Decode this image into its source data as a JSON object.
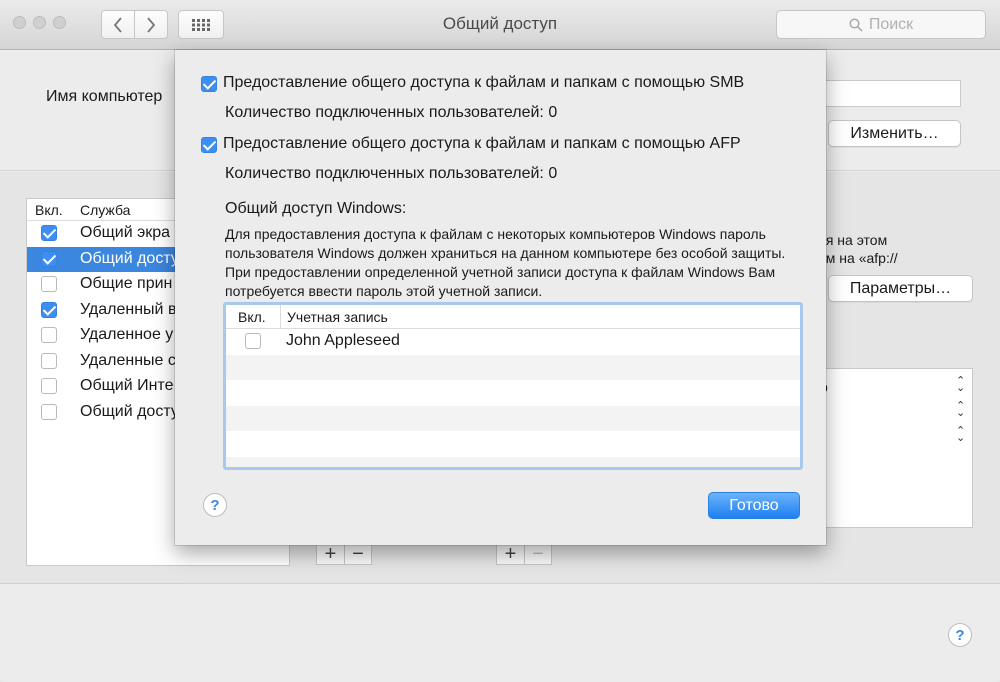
{
  "window": {
    "title": "Общий доступ",
    "search_placeholder": "Поиск"
  },
  "computer_name": {
    "label": "Имя компьютер",
    "change_button": "Изменить…"
  },
  "services": {
    "header_on": "Вкл.",
    "header_service": "Служба",
    "items": [
      {
        "label": "Общий экра",
        "checked": true
      },
      {
        "label": "Общий досту",
        "checked": true,
        "selected": true
      },
      {
        "label": "Общие прин",
        "checked": false
      },
      {
        "label": "Удаленный в",
        "checked": true
      },
      {
        "label": "Удаленное у",
        "checked": false
      },
      {
        "label": "Удаленные с",
        "checked": false
      },
      {
        "label": "Общий Инте",
        "checked": false
      },
      {
        "label": "Общий досту",
        "checked": false
      }
    ]
  },
  "background_right": {
    "text_line1": "ия на этом",
    "text_line2": "ам на «afp://",
    "options_button": "Параметры…",
    "list_fragment": "р"
  },
  "sheet": {
    "smb": {
      "label": "Предоставление общего доступа к файлам и папкам с помощью SMB",
      "checked": true,
      "count": "Количество подключенных пользователей: 0"
    },
    "afp": {
      "label": "Предоставление общего доступа к файлам и папкам с помощью AFP",
      "checked": true,
      "count": "Количество подключенных пользователей: 0"
    },
    "windows_title": "Общий доступ Windows:",
    "windows_description": "Для предоставления доступа к файлам с некоторых компьютеров Windows пароль пользователя Windows должен храниться на данном компьютере без особой защиты. При предоставлении определенной учетной записи доступа к файлам Windows Вам потребуется ввести пароль этой учетной записи.",
    "accounts": {
      "header_on": "Вкл.",
      "header_account": "Учетная запись",
      "rows": [
        {
          "name": "John Appleseed",
          "checked": false
        }
      ]
    },
    "done_button": "Готово"
  },
  "colors": {
    "accent": "#3d8ef0",
    "selection": "#3b86df"
  }
}
